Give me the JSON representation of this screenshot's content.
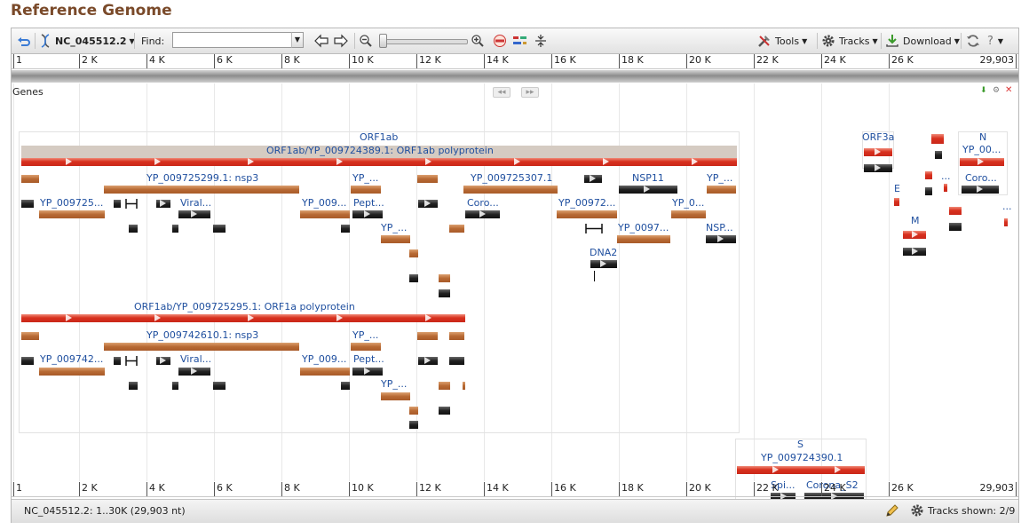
{
  "title": "Reference Genome",
  "toolbar": {
    "refseq": "NC_045512.2",
    "find_label": "Find:",
    "find_value": "",
    "tools_label": "Tools",
    "tracks_label": "Tracks",
    "download_label": "Download",
    "help_label": "?"
  },
  "ruler_ticks": [
    "1",
    "2 K",
    "4 K",
    "6 K",
    "8 K",
    "10 K",
    "12 K",
    "14 K",
    "16 K",
    "18 K",
    "20 K",
    "22 K",
    "24 K",
    "26 K"
  ],
  "ruler_end": "29,903",
  "track": {
    "label": "Genes"
  },
  "features": {
    "orf1ab": "ORF1ab",
    "orf1ab_poly": "ORF1ab/YP_009724389.1: ORF1ab polyprotein",
    "nsp3": "YP_009725299.1: nsp3",
    "yp_a1": "YP_...",
    "yp_725307": "YP_009725307.1",
    "nsp11": "NSP11",
    "yp_a2": "YP_...",
    "yp_725": "YP_009725...",
    "viral1": "Viral...",
    "yp_009a": "YP_009...",
    "pept1": "Pept...",
    "coro1": "Coro...",
    "yp_00972": "YP_00972...",
    "yp_0a": "YP_0...",
    "yp_a3": "YP_...",
    "yp_0097": "YP_0097...",
    "nsp_a": "NSP...",
    "dna2": "DNA2",
    "orf1a_poly": "ORF1ab/YP_009725295.1: ORF1a polyprotein",
    "nsp3b": "YP_009742610.1: nsp3",
    "yp_b1": "YP_...",
    "yp_742": "YP_009742...",
    "viral2": "Viral...",
    "yp_009b": "YP_009...",
    "pept2": "Pept...",
    "yp_b2": "YP_...",
    "orf3a": "ORF3a",
    "n": "N",
    "yp_00n": "YP_00...",
    "e": "E",
    "dots1": "...",
    "coro_n": "Coro...",
    "dots2": "...",
    "m": "M",
    "s": "S",
    "s_yp": "YP_009724390.1",
    "spi": "Spi...",
    "corona_s2": "Corona_S2"
  },
  "status": {
    "location": "NC_045512.2: 1..30K (29,903 nt)",
    "tracks_shown": "Tracks shown: 2/9"
  },
  "colors": {
    "title": "#7a4a2a",
    "feature_red": "#d8311e",
    "feature_orange": "#b86a34",
    "feature_black": "#222222",
    "label_blue": "#1f4f9f"
  }
}
